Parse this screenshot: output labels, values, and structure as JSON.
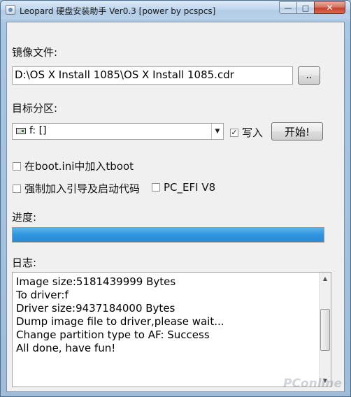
{
  "window": {
    "title": "Leopard 硬盘安装助手 Ver0.3 [power by pcspcs]",
    "minimize_glyph": "—",
    "maximize_glyph": "□",
    "close_glyph": "✕"
  },
  "image_file": {
    "label": "镜像文件:",
    "value": "D:\\OS X Install 1085\\OS X Install 1085.cdr",
    "browse_label": ".."
  },
  "target_partition": {
    "label": "目标分区:",
    "selected": "f: []",
    "write_checked": true,
    "write_label": "写入",
    "start_label": "开始!"
  },
  "options": {
    "tboot_label": "在boot.ini中加入tboot",
    "tboot_checked": false,
    "force_boot_label": "强制加入引导及启动代码",
    "force_boot_checked": false,
    "pc_efi_label": "PC_EFI V8",
    "pc_efi_checked": false
  },
  "progress": {
    "label": "进度:",
    "value_percent": 100
  },
  "log": {
    "label": "日志:",
    "lines": [
      "Image size:5181439999 Bytes",
      "To driver:f",
      "Driver size:9437184000 Bytes",
      "Dump image file to driver,please wait...",
      "Change partition type to AF: Success",
      "All done, have fun!"
    ]
  },
  "watermark": "PConline",
  "colors": {
    "progress_fill": "#2f95de",
    "close_button": "#c4422f"
  }
}
